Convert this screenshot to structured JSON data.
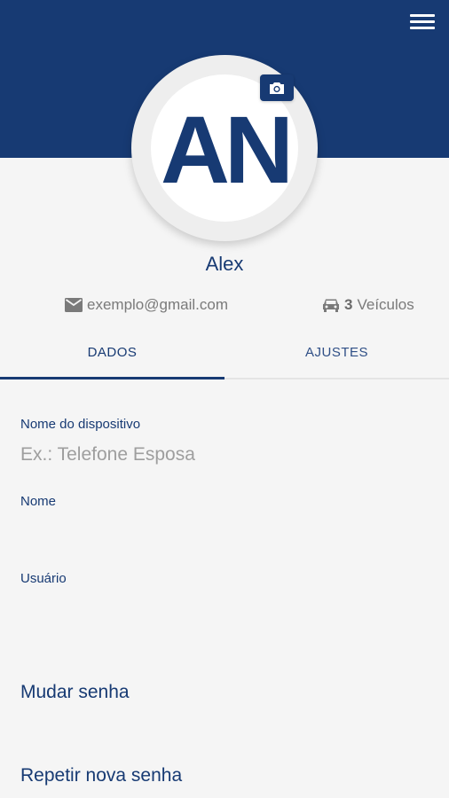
{
  "header": {
    "menu_icon": "hamburger-menu-icon",
    "background": "#173a73"
  },
  "profile": {
    "initials": "AN",
    "name": "Alex",
    "camera_icon": "camera-icon",
    "email": "exemplo@gmail.com",
    "email_icon": "envelope-icon",
    "vehicles_count": "3",
    "vehicles_label": "Veículos",
    "vehicles_icon": "car-icon"
  },
  "tabs": [
    {
      "label": "DADOS",
      "active": true
    },
    {
      "label": "AJUSTES",
      "active": false
    }
  ],
  "form": {
    "device_name": {
      "label": "Nome do dispositivo",
      "placeholder": "Ex.: Telefone Esposa",
      "value": ""
    },
    "name": {
      "label": "Nome",
      "value": ""
    },
    "username": {
      "label": "Usuário",
      "value": ""
    },
    "change_password": "Mudar senha",
    "repeat_password": "Repetir nova senha"
  },
  "colors": {
    "primary": "#173a73",
    "background": "#f5f5f5",
    "muted_text": "#7a7a7a"
  }
}
